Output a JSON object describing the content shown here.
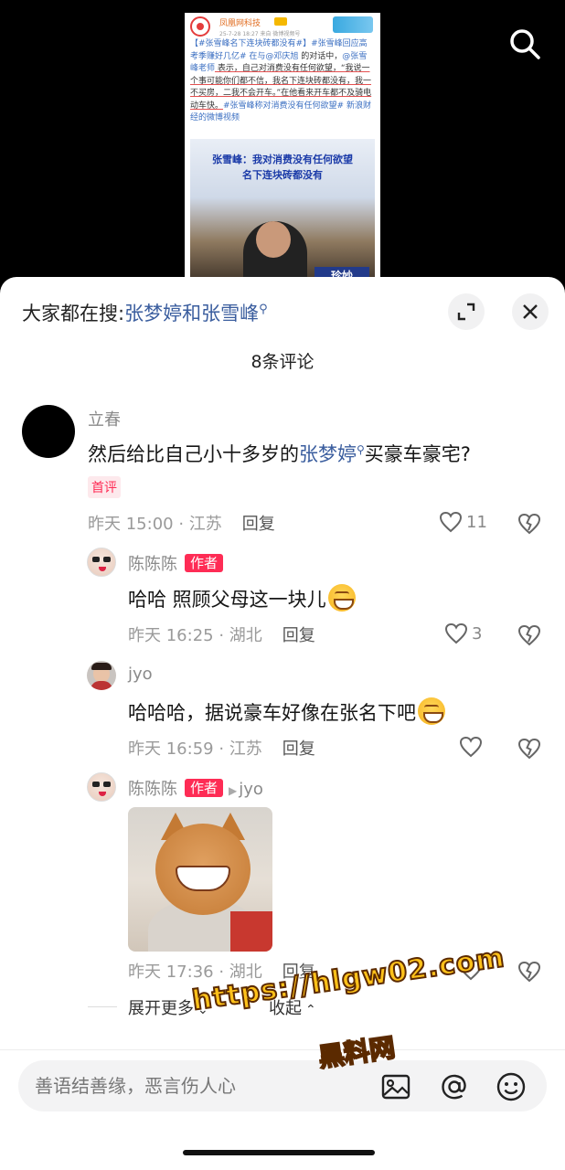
{
  "video": {
    "post": {
      "account": "凤凰网科技",
      "meta": "25-7-28 18:27  来自 微博视频号",
      "text_parts": [
        {
          "t": "【#张雪峰名下连块砖都没有#】#张雪峰回应高考季赚好几亿# 在与",
          "c": "hl"
        },
        {
          "t": "@邓庆旭",
          "c": "hl"
        },
        {
          "t": " 的对话中，",
          "c": ""
        },
        {
          "t": "@张雪峰老师",
          "c": "hl"
        },
        {
          "t": " 表示，自己对消费没有任何欲望，“我说一个事可能你们都不信，我名下连块砖都没有，我一不买房，二我不会开车。”在他看来开车都不及骑电动车快。",
          "c": "ul"
        },
        {
          "t": "#张雪峰称对消费没有任何欲望#",
          "c": "hl"
        },
        {
          "t": " ",
          "c": ""
        },
        {
          "t": "新浪财经的微博视频",
          "c": "hl"
        }
      ],
      "image_title_line1": "张雪峰：我对消费没有任何欲望",
      "image_title_line2": "名下连块砖都没有",
      "image_sign": "珍妙"
    },
    "search_icon": "search-icon"
  },
  "sheet": {
    "hot_search_prefix": "大家都在搜:",
    "hot_search_term": "张梦婷和张雪峰",
    "comment_count_title": "8条评论",
    "expand_icon": "expand-icon",
    "close_icon": "close-icon"
  },
  "comments": [
    {
      "user": "立春",
      "text_before": "然后给比自己小十多岁的",
      "text_term": "张梦婷",
      "text_after": "买豪车豪宅?",
      "badge": "首评",
      "time_location": "昨天 15:00 · 江苏",
      "reply_label": "回复",
      "likes": "11"
    },
    {
      "user": "陈陈陈",
      "author_tag": "作者",
      "text": "哈哈 照顾父母这一块儿",
      "time_location": "昨天 16:25 · 湖北",
      "reply_label": "回复",
      "likes": "3"
    },
    {
      "user": "jyo",
      "text": "哈哈哈，据说豪车好像在张名下吧",
      "time_location": "昨天 16:59 · 江苏",
      "reply_label": "回复",
      "likes": ""
    },
    {
      "user": "陈陈陈",
      "author_tag": "作者",
      "reply_to": "jyo",
      "time_location": "昨天 17:36 · 湖北",
      "reply_label": "回复",
      "likes": ""
    }
  ],
  "more": {
    "expand_more": "展开更多",
    "collapse": "收起"
  },
  "watermark": {
    "url": "https://hlgw02.com",
    "name": "黑料网"
  },
  "input": {
    "placeholder": "善语结善缘，恶言伤人心",
    "image_icon": "image-icon",
    "mention_icon": "at-icon",
    "emoji_icon": "emoji-icon"
  },
  "colors": {
    "accent_red": "#fe2c55",
    "link_blue": "#3a5d9e"
  }
}
